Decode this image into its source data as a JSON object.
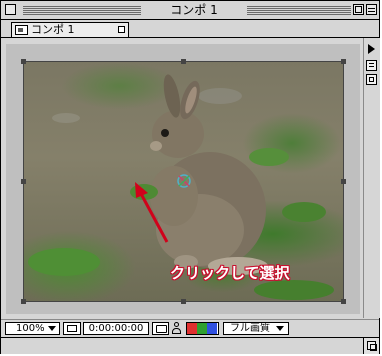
{
  "window": {
    "title": "コンポ 1"
  },
  "tab": {
    "label": "コンポ 1",
    "icon": "composition-icon"
  },
  "viewer": {
    "annotation": "クリックして選択",
    "annotation_color": "#c8102e",
    "arrow_color": "#d0021b"
  },
  "statusbar": {
    "zoom": "100%",
    "timecode": "0:00:00:00",
    "channels": [
      "#e03030",
      "#30a030",
      "#3050e0"
    ],
    "resolution": "フル画質"
  }
}
